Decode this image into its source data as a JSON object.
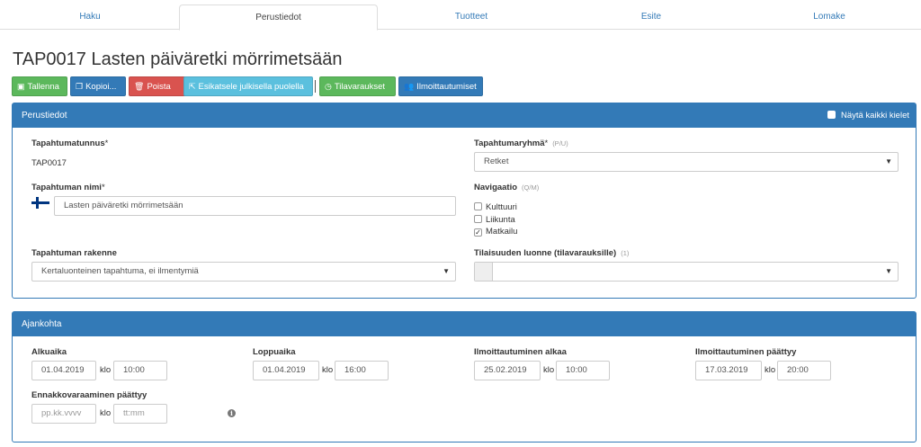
{
  "tabs": [
    {
      "label": "Haku",
      "active": false
    },
    {
      "label": "Perustiedot",
      "active": true
    },
    {
      "label": "Tuotteet",
      "active": false
    },
    {
      "label": "Esite",
      "active": false
    },
    {
      "label": "Lomake",
      "active": false
    }
  ],
  "page_title": "TAP0017 Lasten päiväretki mörrimetsään",
  "toolbar": {
    "save": "Tallenna",
    "copy": "Kopioi...",
    "delete": "Poista",
    "preview": "Esikatsele julkisella puolella",
    "reservations": "Tilavaraukset",
    "registrations": "Ilmoittautumiset",
    "colors": {
      "success": "#5cb85c",
      "primary": "#337ab7",
      "danger": "#d9534f",
      "info": "#5bc0de"
    }
  },
  "basic": {
    "heading": "Perustiedot",
    "show_all_languages": "Näytä kaikki kielet",
    "event_id_label": "Tapahtumatunnus",
    "event_id_value": "TAP0017",
    "event_group_label": "Tapahtumaryhmä",
    "event_group_hint": "(P/U)",
    "event_group_value": "Retket",
    "event_name_label": "Tapahtuman nimi",
    "event_name_value": "Lasten päiväretki mörrimetsään",
    "navigation_label": "Navigaatio",
    "navigation_hint": "(Q/M)",
    "navigation_items": [
      {
        "label": "Kulttuuri",
        "checked": false
      },
      {
        "label": "Liikunta",
        "checked": false
      },
      {
        "label": "Matkailu",
        "checked": true
      }
    ],
    "structure_label": "Tapahtuman rakenne",
    "structure_value": "Kertaluonteinen tapahtuma, ei ilmentymiä",
    "space_type_label": "Tilaisuuden luonne (tilavarauksille)",
    "space_type_hint": "(1)",
    "space_type_value": "",
    "required_marker": "*"
  },
  "timing": {
    "heading": "Ajankohta",
    "klo": "klo",
    "start": {
      "label": "Alkuaika",
      "date": "01.04.2019",
      "time": "10:00"
    },
    "end": {
      "label": "Loppuaika",
      "date": "01.04.2019",
      "time": "16:00"
    },
    "reg_start": {
      "label": "Ilmoittautuminen alkaa",
      "date": "25.02.2019",
      "time": "10:00"
    },
    "reg_end": {
      "label": "Ilmoittautuminen päättyy",
      "date": "17.03.2019",
      "time": "20:00"
    },
    "prebook_end": {
      "label": "Ennakkovaraaminen päättyy",
      "date_placeholder": "pp.kk.vvvv",
      "time_placeholder": "tt:mm"
    }
  },
  "icons": {
    "save": "floppy-icon",
    "copy": "copy-icon",
    "delete": "trash-icon",
    "preview": "external-link-icon",
    "reservations": "clock-icon",
    "registrations": "users-icon",
    "flag": "finland-flag-icon",
    "info": "info-icon"
  }
}
